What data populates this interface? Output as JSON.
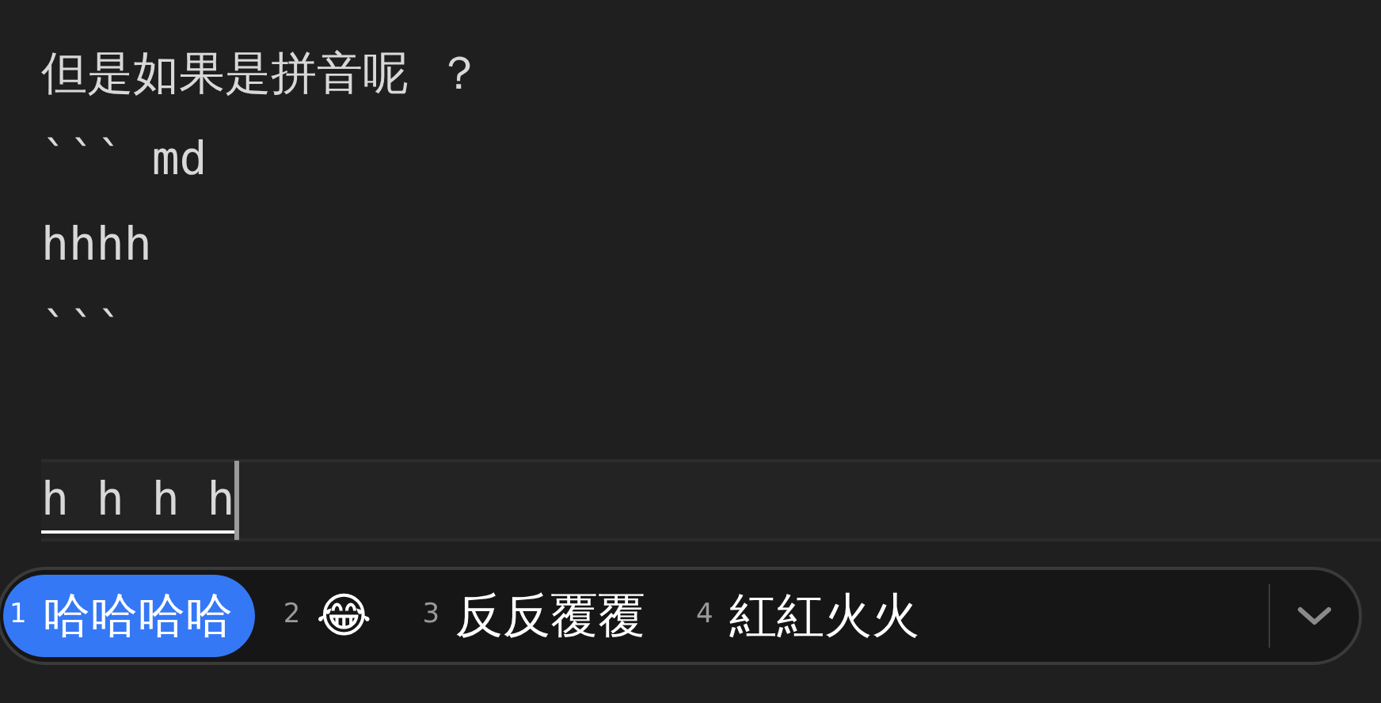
{
  "editor": {
    "lines": [
      "但是如果是拼音呢 ？",
      "``` md",
      "hhhh",
      "```"
    ],
    "composition": "h h h h"
  },
  "candidate_bar": {
    "candidates": [
      {
        "number": "1",
        "text": "哈哈哈哈",
        "selected": true
      },
      {
        "number": "2",
        "text": "😂",
        "selected": false
      },
      {
        "number": "3",
        "text": "反反覆覆",
        "selected": false
      },
      {
        "number": "4",
        "text": "紅紅火火",
        "selected": false
      }
    ]
  }
}
